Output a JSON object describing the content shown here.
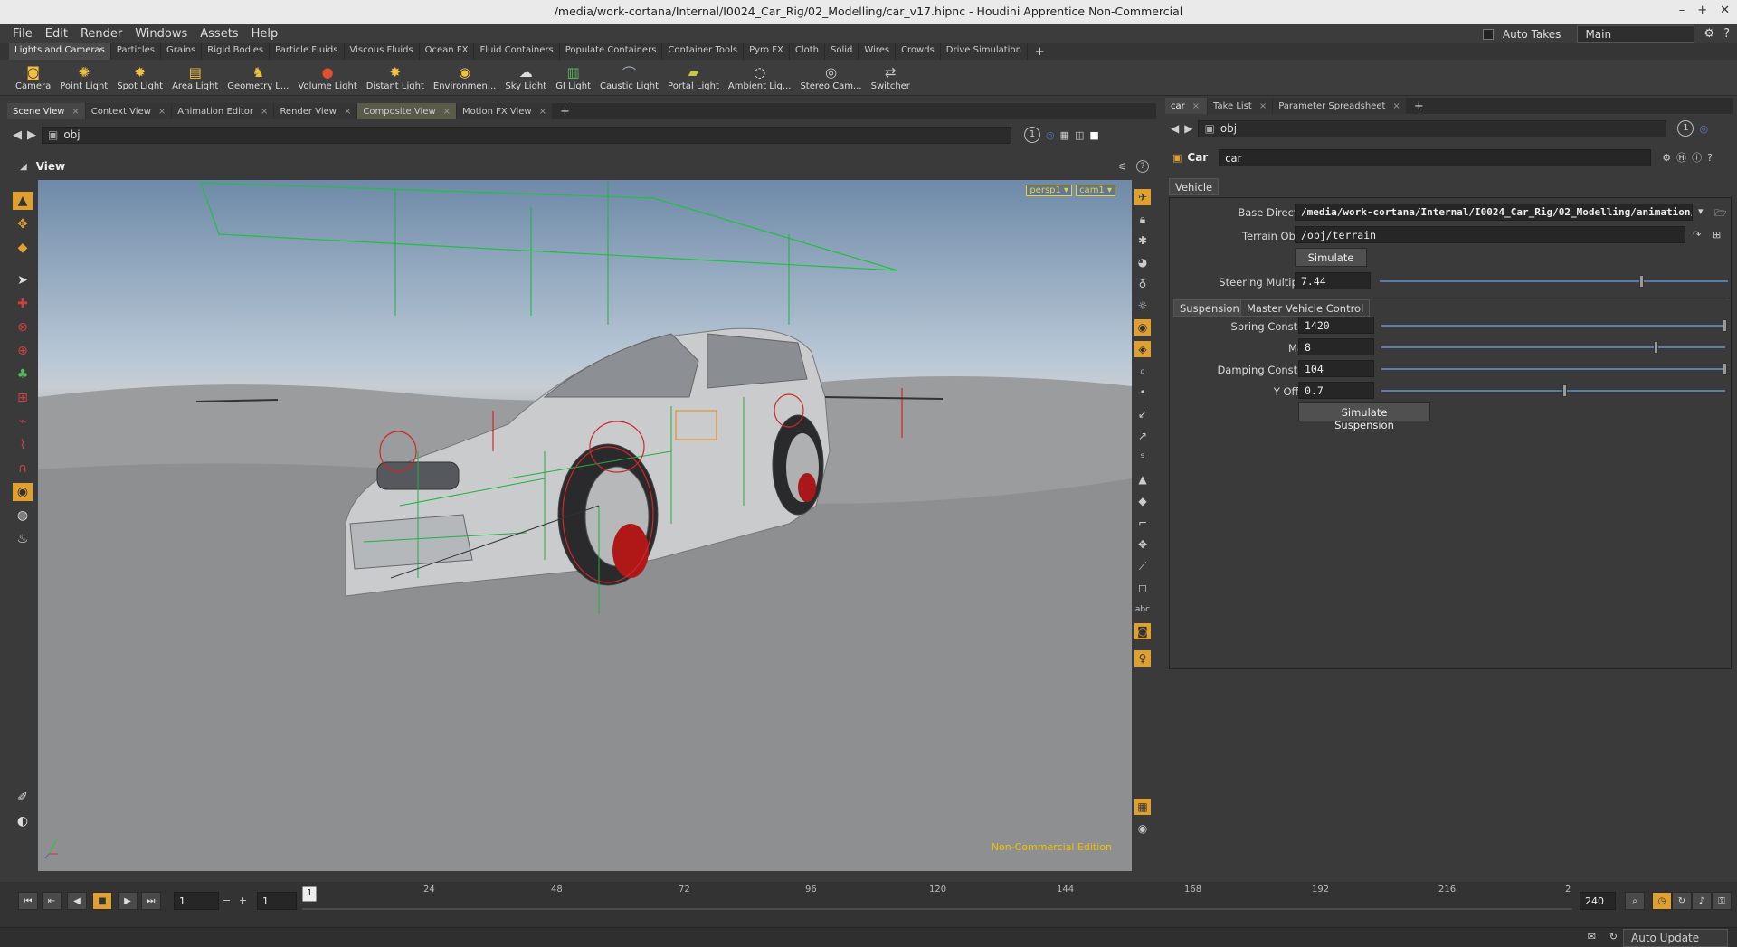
{
  "window": {
    "title": "/media/work-cortana/Internal/I0024_Car_Rig/02_Modelling/car_v17.hipnc - Houdini Apprentice Non-Commercial"
  },
  "menubar": {
    "items": [
      "File",
      "Edit",
      "Render",
      "Windows",
      "Assets",
      "Help"
    ],
    "auto_takes_label": "Auto Takes",
    "desktop_value": "Main"
  },
  "shelf": {
    "tabs": [
      "Lights and Cameras",
      "Particles",
      "Grains",
      "Rigid Bodies",
      "Particle Fluids",
      "Viscous Fluids",
      "Ocean FX",
      "Fluid Containers",
      "Populate Containers",
      "Container Tools",
      "Pyro FX",
      "Cloth",
      "Solid",
      "Wires",
      "Crowds",
      "Drive Simulation"
    ],
    "tools": [
      {
        "label": "Camera",
        "icon": "camera-icon"
      },
      {
        "label": "Point Light",
        "icon": "point-light-icon"
      },
      {
        "label": "Spot Light",
        "icon": "spot-light-icon"
      },
      {
        "label": "Area Light",
        "icon": "area-light-icon"
      },
      {
        "label": "Geometry L...",
        "icon": "geometry-light-icon"
      },
      {
        "label": "Volume Light",
        "icon": "volume-light-icon"
      },
      {
        "label": "Distant Light",
        "icon": "distant-light-icon"
      },
      {
        "label": "Environmen...",
        "icon": "environment-light-icon"
      },
      {
        "label": "Sky Light",
        "icon": "sky-light-icon"
      },
      {
        "label": "GI Light",
        "icon": "gi-light-icon"
      },
      {
        "label": "Caustic Light",
        "icon": "caustic-light-icon"
      },
      {
        "label": "Portal Light",
        "icon": "portal-light-icon"
      },
      {
        "label": "Ambient Lig...",
        "icon": "ambient-light-icon"
      },
      {
        "label": "Stereo Cam...",
        "icon": "stereo-camera-icon"
      },
      {
        "label": "Switcher",
        "icon": "switcher-icon"
      }
    ]
  },
  "left_pane": {
    "tabs": [
      "Scene View",
      "Context View",
      "Animation Editor",
      "Render View",
      "Composite View",
      "Motion FX View"
    ],
    "path": "obj",
    "viewer_title": "View",
    "camera_menu": "persp1",
    "cam_menu": "cam1",
    "watermark": "Non-Commercial Edition",
    "page_number": "1"
  },
  "right_pane": {
    "tabs": [
      "car",
      "Take List",
      "Parameter Spreadsheet"
    ],
    "path": "obj",
    "node_type": "Car",
    "node_name": "car",
    "folder_tab": "Vehicle",
    "params": {
      "base_directory_label": "Base Directory",
      "base_directory_value": "/media/work-cortana/Internal/I0024_Car_Rig/02_Modelling/animation/",
      "terrain_object_label": "Terrain Object",
      "terrain_object_value": "/obj/terrain",
      "simulate_label": "Simulate",
      "steering_multiplier_label": "Steering Multiplier",
      "steering_multiplier_value": "7.44",
      "steering_multiplier_fraction": 0.75
    },
    "subtabs": [
      "Suspension",
      "Master Vehicle Control"
    ],
    "suspension": {
      "spring_constant_label": "Spring Constant",
      "spring_constant_value": "1420",
      "spring_constant_fraction": 1.0,
      "mass_label": "Mass",
      "mass_value": "8",
      "mass_fraction": 0.8,
      "damping_constant_label": "Damping Constant",
      "damping_constant_value": "104",
      "damping_constant_fraction": 1.0,
      "y_offset_label": "Y Offset",
      "y_offset_value": "0.7",
      "y_offset_fraction": 0.53,
      "simulate_suspension_label": "Simulate Suspension"
    }
  },
  "timeline": {
    "current_frame": "1",
    "step": "1",
    "start_frame": "1",
    "end_frame": "240",
    "marker": "1",
    "ticks": [
      "24",
      "48",
      "72",
      "96",
      "120",
      "144",
      "168",
      "192",
      "216",
      "2"
    ]
  },
  "status": {
    "auto_update_label": "Auto Update"
  },
  "colors": {
    "accent": "#f0c040",
    "slider": "#5a7da8",
    "watermark": "#f0c000"
  }
}
